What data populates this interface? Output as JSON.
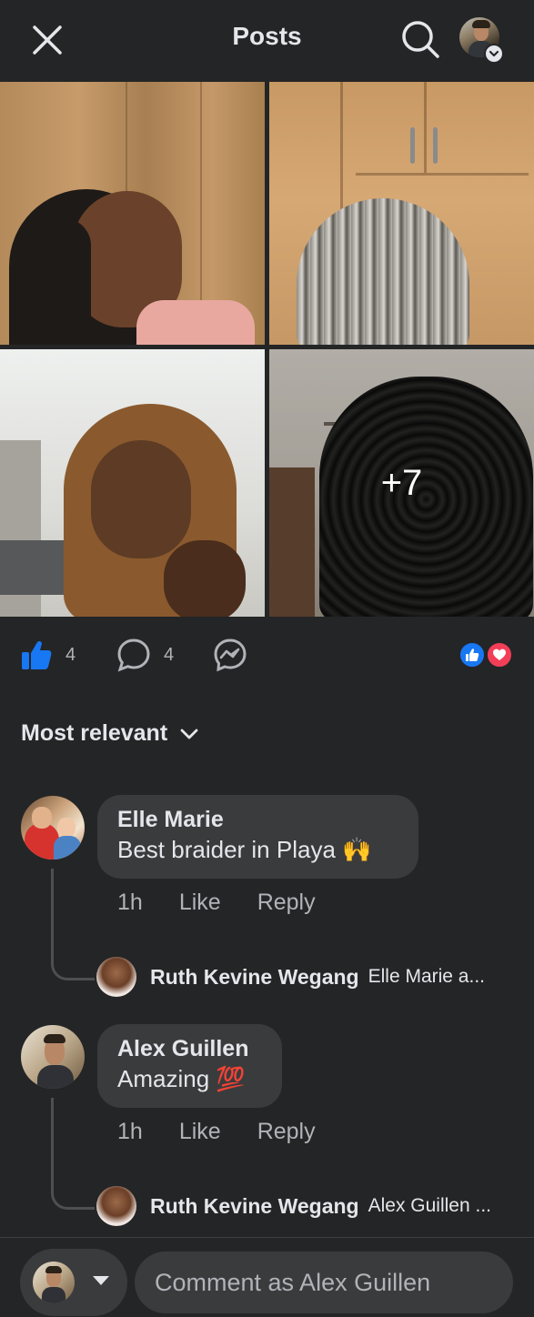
{
  "header": {
    "title": "Posts",
    "close_icon": "close-icon",
    "search_icon": "search-icon",
    "profile_icon": "profile-avatar"
  },
  "photos": {
    "count": 4,
    "more_label": "+7"
  },
  "actions": {
    "like_count": "4",
    "comment_count": "4",
    "like_icon": "thumbs-up-icon",
    "comment_icon": "comment-bubble-icon",
    "share_icon": "messenger-icon",
    "reactions": [
      "like",
      "love"
    ]
  },
  "sort": {
    "label": "Most relevant",
    "icon": "chevron-down-icon"
  },
  "comments": [
    {
      "author": "Elle Marie",
      "text": "Best braider in Playa 🙌",
      "time": "1h",
      "like_label": "Like",
      "reply_label": "Reply",
      "reply": {
        "author": "Ruth Kevine Wegang",
        "preview": "Elle Marie a..."
      }
    },
    {
      "author": "Alex Guillen",
      "text": "Amazing 💯",
      "time": "1h",
      "like_label": "Like",
      "reply_label": "Reply",
      "reply": {
        "author": "Ruth Kevine Wegang",
        "preview": "Alex Guillen ..."
      }
    }
  ],
  "composer": {
    "placeholder": "Comment as Alex Guillen"
  },
  "colors": {
    "background": "#242526",
    "bubble": "#3a3b3c",
    "text_primary": "#e4e6eb",
    "text_secondary": "#b0b3b8",
    "like_blue": "#1877f2",
    "love_red": "#f33e58"
  }
}
